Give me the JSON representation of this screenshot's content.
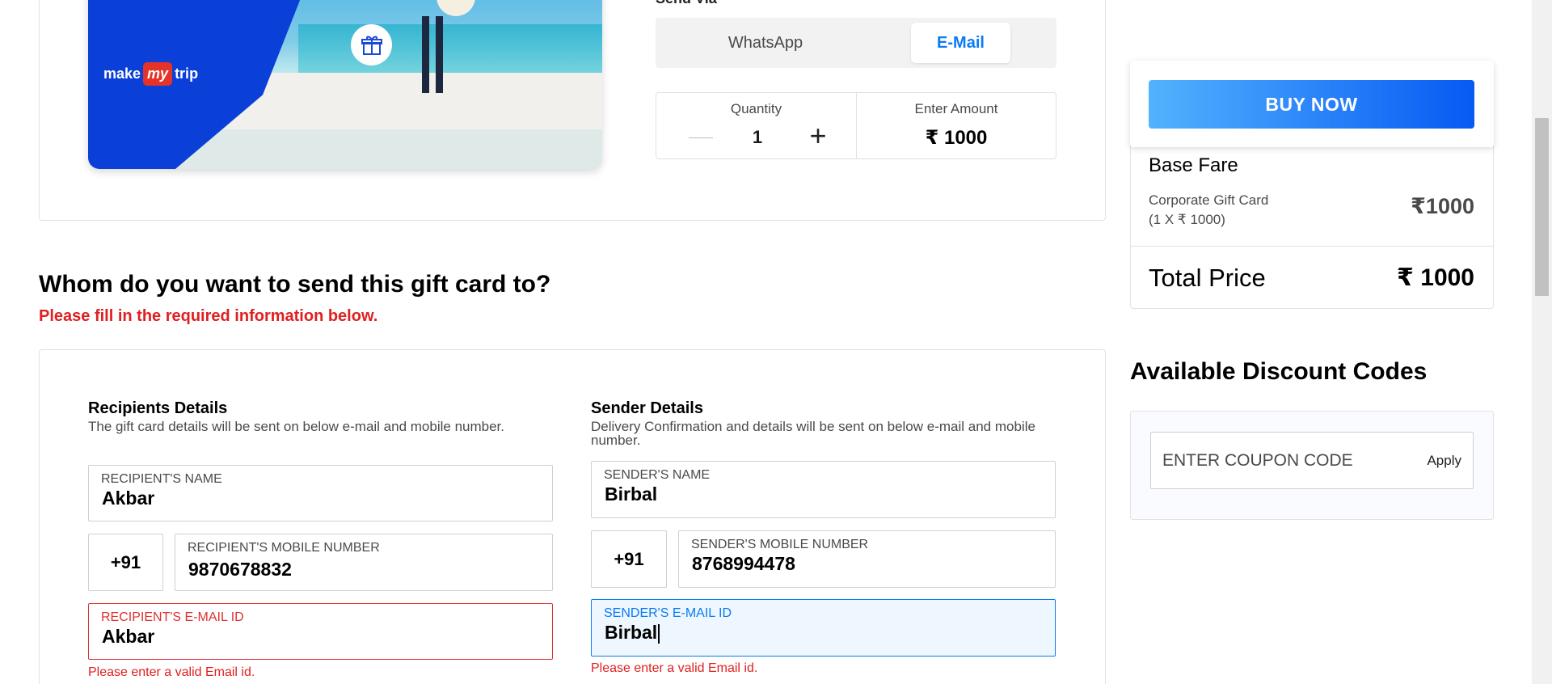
{
  "send_via": {
    "label": "Send Via",
    "options": [
      "WhatsApp",
      "E-Mail"
    ],
    "selected": "E-Mail"
  },
  "gift_card": {
    "brand_prefix": "make",
    "brand_mark": "my",
    "brand_suffix": "trip"
  },
  "quantity": {
    "label": "Quantity",
    "value": "1"
  },
  "amount": {
    "label": "Enter Amount",
    "value": "₹ 1000"
  },
  "section": {
    "title": "Whom do you want to send this gift card to?",
    "subtitle": "Please fill in the required information below."
  },
  "recipient": {
    "title": "Recipients Details",
    "description": "The gift card details will be sent on below e-mail and mobile number.",
    "name_label": "RECIPIENT'S NAME",
    "name_value": "Akbar",
    "country_code": "+91",
    "mobile_label": "RECIPIENT'S MOBILE NUMBER",
    "mobile_value": "9870678832",
    "email_label": "RECIPIENT'S E-MAIL ID",
    "email_value": "Akbar",
    "email_error": "Please enter a valid Email id."
  },
  "sender": {
    "title": "Sender Details",
    "description_line1": "Delivery Confirmation and details will be sent on below e-mail and mobile",
    "description_line2": "number.",
    "name_label": "SENDER'S NAME",
    "name_value": "Birbal",
    "country_code": "+91",
    "mobile_label": "SENDER'S MOBILE NUMBER",
    "mobile_value": "8768994478",
    "email_label": "SENDER'S E-MAIL ID",
    "email_value": "Birbal",
    "email_error": "Please enter a valid Email id."
  },
  "price_summary": {
    "buy_now": "BUY NOW",
    "base_fare": "Base Fare",
    "item_name": "Corporate Gift Card",
    "item_detail": "(1 X ₹ 1000)",
    "item_price": "₹1000",
    "total_label": "Total Price",
    "total_value": "₹ 1000"
  },
  "discount": {
    "title": "Available Discount Codes",
    "coupon_placeholder": "ENTER COUPON CODE",
    "apply_label": "Apply"
  },
  "colors": {
    "accent_blue": "#0a7bf5",
    "error_red": "#e02020",
    "buy_gradient_start": "#53b2fe",
    "buy_gradient_end": "#065af3"
  },
  "icons": [
    "gift-icon",
    "minus-icon",
    "plus-icon"
  ]
}
